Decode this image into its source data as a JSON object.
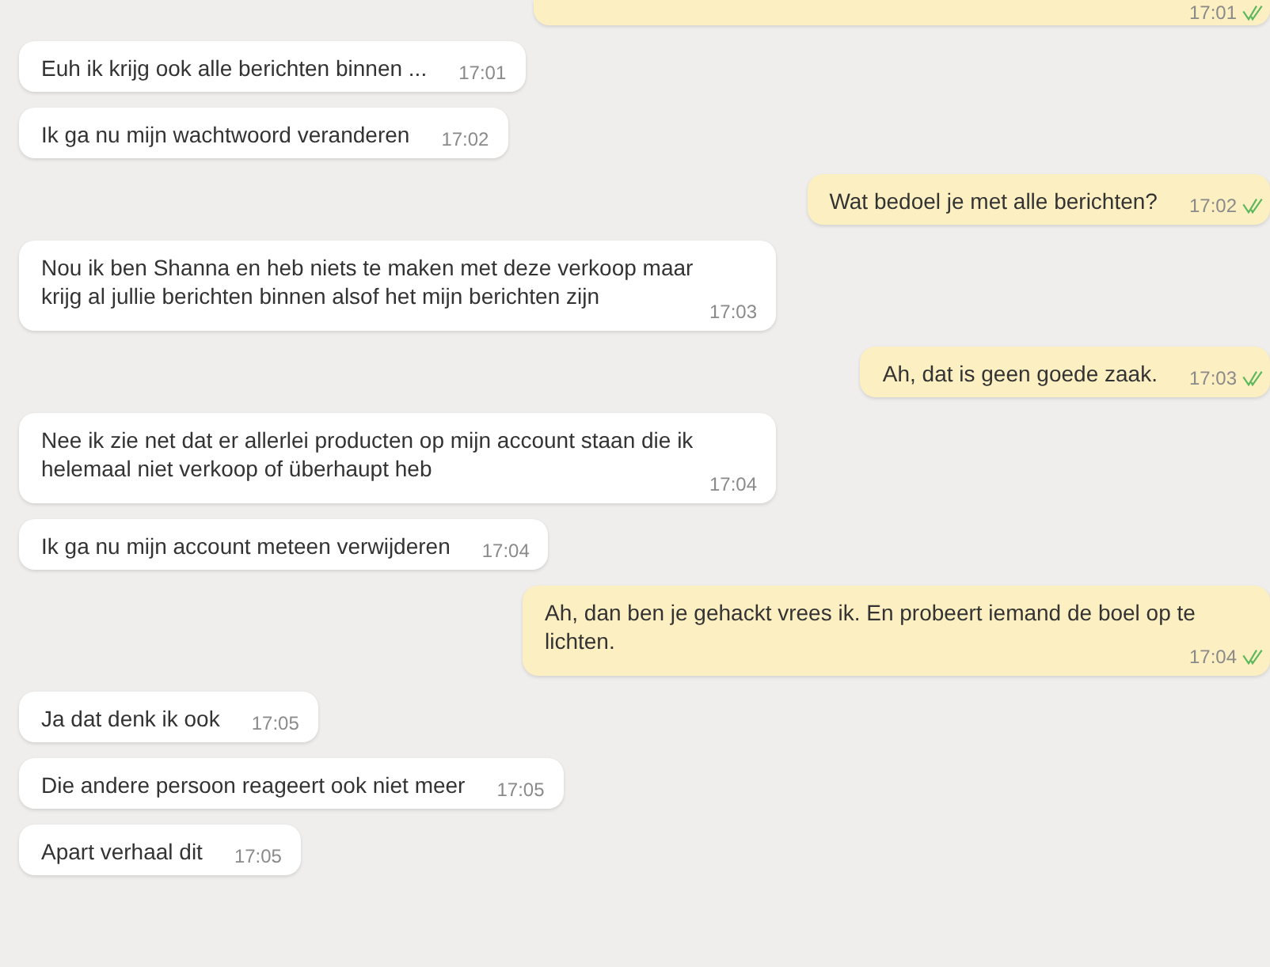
{
  "messages": [
    {
      "kind": "sent",
      "time": "17:01",
      "read": true
    },
    {
      "kind": "received",
      "text": "Euh ik krijg ook alle berichten binnen ...",
      "time": "17:01"
    },
    {
      "kind": "received",
      "text": "Ik ga nu mijn wachtwoord veranderen",
      "time": "17:02"
    },
    {
      "kind": "sent",
      "text": "Wat bedoel je met alle berichten?",
      "time": "17:02",
      "read": true
    },
    {
      "kind": "received",
      "text": "Nou ik ben Shanna en heb niets te maken met deze verkoop maar krijg al jullie berichten binnen alsof het mijn berichten zijn",
      "time": "17:03"
    },
    {
      "kind": "sent",
      "text": "Ah, dat is geen goede zaak.",
      "time": "17:03",
      "read": true
    },
    {
      "kind": "received",
      "text": "Nee ik zie net dat er allerlei producten op mijn account staan die ik helemaal niet verkoop of überhaupt heb",
      "time": "17:04"
    },
    {
      "kind": "received",
      "text": "Ik ga nu mijn account meteen verwijderen",
      "time": "17:04"
    },
    {
      "kind": "sent",
      "text": "Ah, dan ben je gehackt vrees ik. En probeert iemand de boel op te lichten.",
      "time": "17:04",
      "read": true
    },
    {
      "kind": "received",
      "text": "Ja dat denk ik ook",
      "time": "17:05"
    },
    {
      "kind": "received",
      "text": "Die andere persoon reageert ook niet meer",
      "time": "17:05"
    },
    {
      "kind": "received",
      "text": "Apart verhaal dit",
      "time": "17:05"
    }
  ]
}
